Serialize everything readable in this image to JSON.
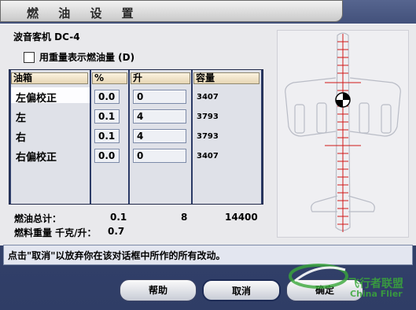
{
  "window": {
    "title": "燃 油 设 置"
  },
  "aircraft": {
    "name": "波音客机 DC-4"
  },
  "weight_option": {
    "label": "用重量表示燃油量 (D)",
    "checked": false
  },
  "table": {
    "headers": {
      "tank": "油箱",
      "percent": "%",
      "liters": "升",
      "capacity": "容量"
    },
    "rows": [
      {
        "tank": "左偏校正",
        "percent": "0.0",
        "liters": "0",
        "capacity": "3407"
      },
      {
        "tank": "左",
        "percent": "0.1",
        "liters": "4",
        "capacity": "3793"
      },
      {
        "tank": "右",
        "percent": "0.1",
        "liters": "4",
        "capacity": "3793"
      },
      {
        "tank": "右偏校正",
        "percent": "0.0",
        "liters": "0",
        "capacity": "3407"
      }
    ]
  },
  "totals": {
    "label": "燃油总计：",
    "percent": "0.1",
    "liters": "8",
    "capacity": "14400"
  },
  "density": {
    "label": "燃料重量 千克/升：",
    "value": "0.7"
  },
  "status": {
    "text": "点击\"取消\"以放弃你在该对话框中所作的所有改动。"
  },
  "buttons": {
    "help": "帮助",
    "cancel": "取消",
    "ok": "确定"
  },
  "watermark": {
    "text": "飞行者联盟",
    "sub": "China Flier"
  },
  "colors": {
    "accent_red": "#d01818",
    "frame_blue": "#2b3a66",
    "watermark_green": "#3aa83a"
  }
}
